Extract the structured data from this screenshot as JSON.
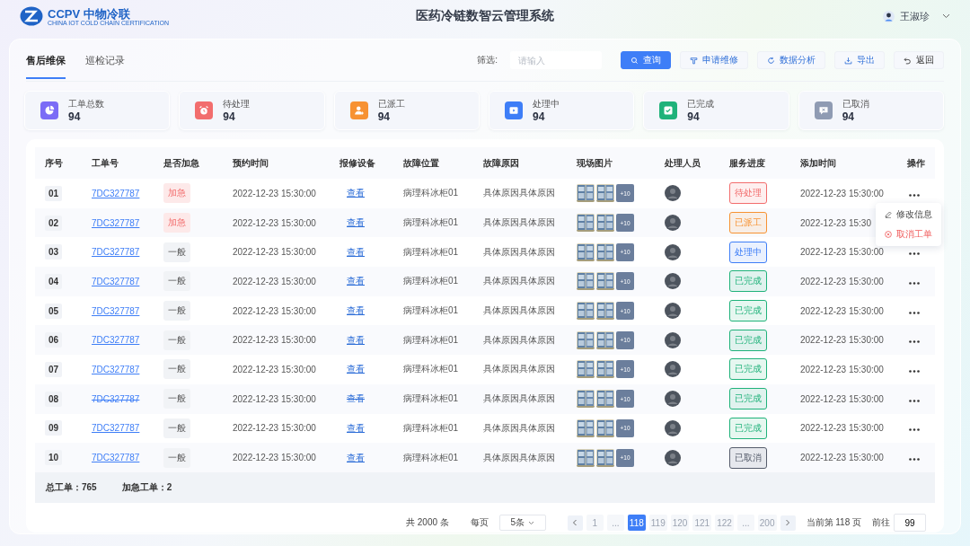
{
  "header": {
    "brand": "CCPV 中物冷联",
    "brand_sub": "CHINA IOT COLD CHAIN CERTIFICATION",
    "title": "医药冷链数智云管理系统",
    "user": "王淑珍"
  },
  "tabs": [
    {
      "label": "售后维保",
      "selected": true
    },
    {
      "label": "巡检记录",
      "selected": false
    }
  ],
  "filter": {
    "label": "筛选:",
    "placeholder": "请输入"
  },
  "actions": [
    {
      "label": "查询",
      "kind": "search",
      "primary": true
    },
    {
      "label": "申请维修",
      "kind": "repair",
      "primary": false
    },
    {
      "label": "数据分析",
      "kind": "analysis",
      "primary": false
    },
    {
      "label": "导出",
      "kind": "export",
      "primary": false
    },
    {
      "label": "返回",
      "kind": "back",
      "primary": false
    }
  ],
  "stats": [
    {
      "label": "工单总数",
      "value": "94",
      "kind": "pie",
      "color": "#7b6cf6"
    },
    {
      "label": "待处理",
      "value": "94",
      "kind": "alarm",
      "color": "#f26d6d"
    },
    {
      "label": "已派工",
      "value": "94",
      "kind": "user",
      "color": "#f79232"
    },
    {
      "label": "处理中",
      "value": "94",
      "kind": "play",
      "color": "#3e7ef7"
    },
    {
      "label": "已完成",
      "value": "94",
      "kind": "check",
      "color": "#1fb27a"
    },
    {
      "label": "已取消",
      "value": "94",
      "kind": "cancel",
      "color": "#8f9bb3"
    }
  ],
  "table": {
    "columns": [
      "序号",
      "工单号",
      "是否加急",
      "预约时间",
      "报修设备",
      "故障位置",
      "故障原因",
      "现场图片",
      "处理人员",
      "服务进度",
      "添加时间",
      "操作"
    ],
    "rows": [
      {
        "no": "01",
        "code": "7DC327787",
        "struck": false,
        "urgent": true,
        "priority": "加急",
        "time": "2022-12-23 15:30:00",
        "device": "查看",
        "location": "病理科冰柜01",
        "reason": "具体原因具体原因",
        "more_photos": "+10",
        "status": "待处理",
        "color": "#f26d6d",
        "added": "2022-12-23 15:30:00",
        "menu": [
          {
            "label": "修改信息",
            "kind": "edit"
          },
          {
            "label": "取消工单",
            "kind": "cancel"
          }
        ]
      },
      {
        "no": "02",
        "code": "7DC327787",
        "struck": false,
        "urgent": true,
        "priority": "加急",
        "time": "2022-12-23 15:30:00",
        "device": "查看",
        "location": "病理科冰柜01",
        "reason": "具体原因具体原因",
        "more_photos": "+10",
        "status": "已派工",
        "color": "#f79232",
        "added": "2022-12-23 15:30"
      },
      {
        "no": "03",
        "code": "7DC327787",
        "struck": false,
        "urgent": false,
        "priority": "一般",
        "time": "2022-12-23 15:30:00",
        "device": "查看",
        "location": "病理科冰柜01",
        "reason": "具体原因具体原因",
        "more_photos": "+10",
        "status": "处理中",
        "color": "#3e7ef7",
        "added": "2022-12-23 15:30:00"
      },
      {
        "no": "04",
        "code": "7DC327787",
        "struck": false,
        "urgent": false,
        "priority": "一般",
        "time": "2022-12-23 15:30:00",
        "device": "查看",
        "location": "病理科冰柜01",
        "reason": "具体原因具体原因",
        "more_photos": "+10",
        "status": "已完成",
        "color": "#1fb27a",
        "added": "2022-12-23 15:30:00"
      },
      {
        "no": "05",
        "code": "7DC327787",
        "struck": false,
        "urgent": false,
        "priority": "一般",
        "time": "2022-12-23 15:30:00",
        "device": "查看",
        "location": "病理科冰柜01",
        "reason": "具体原因具体原因",
        "more_photos": "+10",
        "status": "已完成",
        "color": "#1fb27a",
        "added": "2022-12-23 15:30:00"
      },
      {
        "no": "06",
        "code": "7DC327787",
        "struck": false,
        "urgent": false,
        "priority": "一般",
        "time": "2022-12-23 15:30:00",
        "device": "查看",
        "location": "病理科冰柜01",
        "reason": "具体原因具体原因",
        "more_photos": "+10",
        "status": "已完成",
        "color": "#1fb27a",
        "added": "2022-12-23 15:30:00"
      },
      {
        "no": "07",
        "code": "7DC327787",
        "struck": false,
        "urgent": false,
        "priority": "一般",
        "time": "2022-12-23 15:30:00",
        "device": "查看",
        "location": "病理科冰柜01",
        "reason": "具体原因具体原因",
        "more_photos": "+10",
        "status": "已完成",
        "color": "#1fb27a",
        "added": "2022-12-23 15:30:00"
      },
      {
        "no": "08",
        "code": "7DC327787",
        "struck": true,
        "urgent": false,
        "priority": "一般",
        "time": "2022-12-23 15:30:00",
        "device": "查看",
        "location": "病理科冰柜01",
        "reason": "具体原因具体原因",
        "more_photos": "+10",
        "status": "已完成",
        "color": "#1fb27a",
        "added": "2022-12-23 15:30:00"
      },
      {
        "no": "09",
        "code": "7DC327787",
        "struck": false,
        "urgent": false,
        "priority": "一般",
        "time": "2022-12-23 15:30:00",
        "device": "查看",
        "location": "病理科冰柜01",
        "reason": "具体原因具体原因",
        "more_photos": "+10",
        "status": "已完成",
        "color": "#1fb27a",
        "added": "2022-12-23 15:30:00"
      },
      {
        "no": "10",
        "code": "7DC327787",
        "struck": false,
        "urgent": false,
        "priority": "一般",
        "time": "2022-12-23 15:30:00",
        "device": "查看",
        "location": "病理科冰柜01",
        "reason": "具体原因具体原因",
        "more_photos": "+10",
        "status": "已取消",
        "color": "#555c6b",
        "added": "2022-12-23 15:30:00"
      }
    ]
  },
  "summary": [
    "总工单：765",
    "加急工单：2"
  ],
  "pagination": {
    "total": "共 2000 条",
    "per_page_label": "每页",
    "per_page": "5条",
    "pages": [
      {
        "label": "1",
        "selected": false
      },
      {
        "label": "...",
        "selected": false
      },
      {
        "label": "118",
        "selected": true
      },
      {
        "label": "119",
        "selected": false
      },
      {
        "label": "120",
        "selected": false
      },
      {
        "label": "121",
        "selected": false
      },
      {
        "label": "122",
        "selected": false
      },
      {
        "label": "...",
        "selected": false
      },
      {
        "label": "200",
        "selected": false
      }
    ],
    "current": "当前第 118 页",
    "goto": "前往",
    "goto_value": "99"
  }
}
